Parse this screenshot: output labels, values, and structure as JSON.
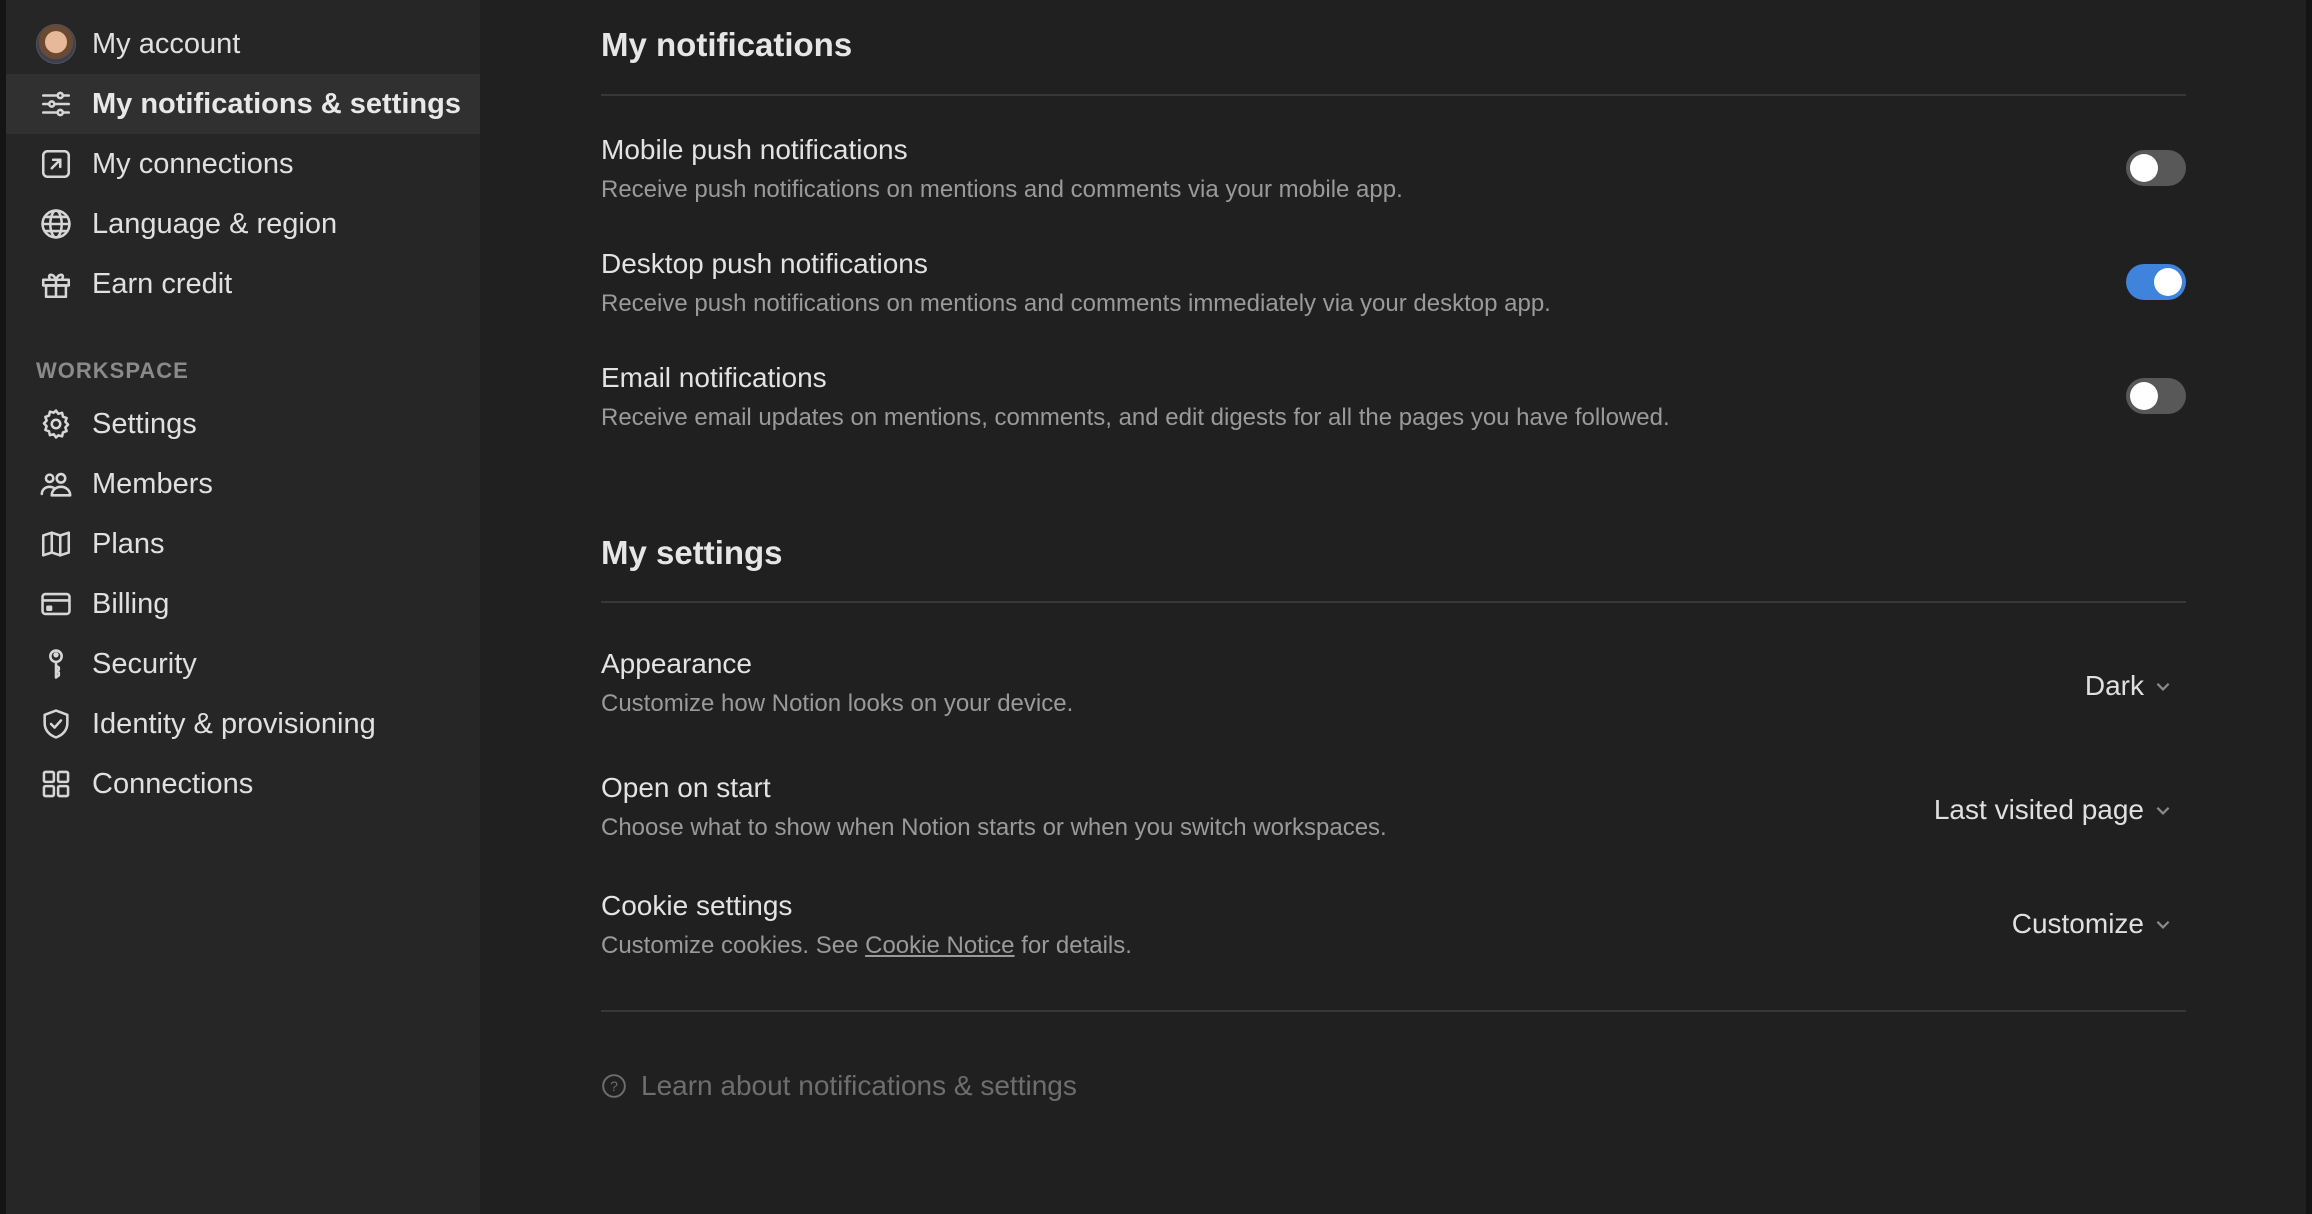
{
  "sidebar": {
    "account_items": [
      {
        "label": "My account",
        "icon": "avatar"
      },
      {
        "label": "My notifications & settings",
        "icon": "sliders-icon",
        "active": true
      },
      {
        "label": "My connections",
        "icon": "arrow-up-right-square-icon"
      },
      {
        "label": "Language & region",
        "icon": "globe-icon"
      },
      {
        "label": "Earn credit",
        "icon": "gift-icon"
      }
    ],
    "workspace_label": "WORKSPACE",
    "workspace_items": [
      {
        "label": "Settings",
        "icon": "gear-icon"
      },
      {
        "label": "Members",
        "icon": "people-icon"
      },
      {
        "label": "Plans",
        "icon": "map-icon"
      },
      {
        "label": "Billing",
        "icon": "credit-card-icon"
      },
      {
        "label": "Security",
        "icon": "key-icon"
      },
      {
        "label": "Identity & provisioning",
        "icon": "shield-check-icon"
      },
      {
        "label": "Connections",
        "icon": "grid-icon"
      }
    ]
  },
  "notifications": {
    "title": "My notifications",
    "items": [
      {
        "title": "Mobile push notifications",
        "desc": "Receive push notifications on mentions and comments via your mobile app.",
        "enabled": false
      },
      {
        "title": "Desktop push notifications",
        "desc": "Receive push notifications on mentions and comments immediately via your desktop app.",
        "enabled": true
      },
      {
        "title": "Email notifications",
        "desc": "Receive email updates on mentions, comments, and edit digests for all the pages you have followed.",
        "enabled": false
      }
    ]
  },
  "settings": {
    "title": "My settings",
    "appearance": {
      "title": "Appearance",
      "desc": "Customize how Notion looks on your device.",
      "value": "Dark"
    },
    "open_on_start": {
      "title": "Open on start",
      "desc": "Choose what to show when Notion starts or when you switch workspaces.",
      "value": "Last visited page"
    },
    "cookies": {
      "title": "Cookie settings",
      "desc_pre": "Customize cookies. See ",
      "link": "Cookie Notice",
      "desc_post": " for details.",
      "value": "Customize"
    }
  },
  "learn_link": "Learn about notifications & settings",
  "colors": {
    "toggle_on": "#3f83dc",
    "toggle_off": "#585858"
  }
}
